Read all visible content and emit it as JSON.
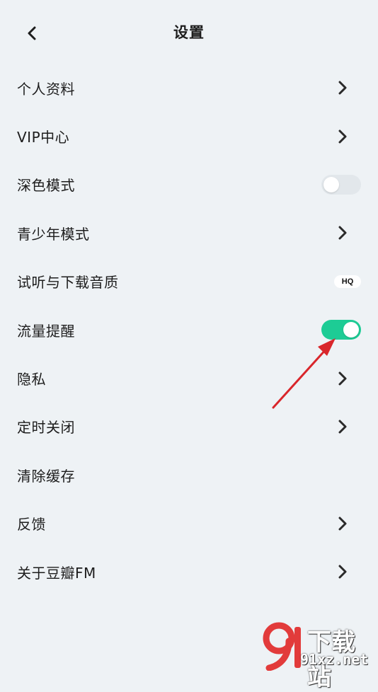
{
  "header": {
    "title": "设置",
    "back_icon": "chevron-left-icon"
  },
  "settings": [
    {
      "label": "个人资料",
      "control": "chevron"
    },
    {
      "label": "VIP中心",
      "control": "chevron"
    },
    {
      "label": "深色模式",
      "control": "toggle",
      "on": false
    },
    {
      "label": "青少年模式",
      "control": "chevron"
    },
    {
      "label": "试听与下载音质",
      "control": "badge",
      "badge": "HQ"
    },
    {
      "label": "流量提醒",
      "control": "toggle",
      "on": true
    },
    {
      "label": "隐私",
      "control": "chevron"
    },
    {
      "label": "定时关闭",
      "control": "chevron"
    },
    {
      "label": "清除缓存",
      "control": "none"
    },
    {
      "label": "反馈",
      "control": "chevron"
    },
    {
      "label": "关于豆瓣FM",
      "control": "chevron"
    }
  ],
  "colors": {
    "background": "#eef2f5",
    "toggle_on": "#1dcc95",
    "toggle_off": "#e2e7eb",
    "annotation_arrow": "#d9262b"
  },
  "watermark": {
    "text": "下载站",
    "url": "91xz.net"
  }
}
